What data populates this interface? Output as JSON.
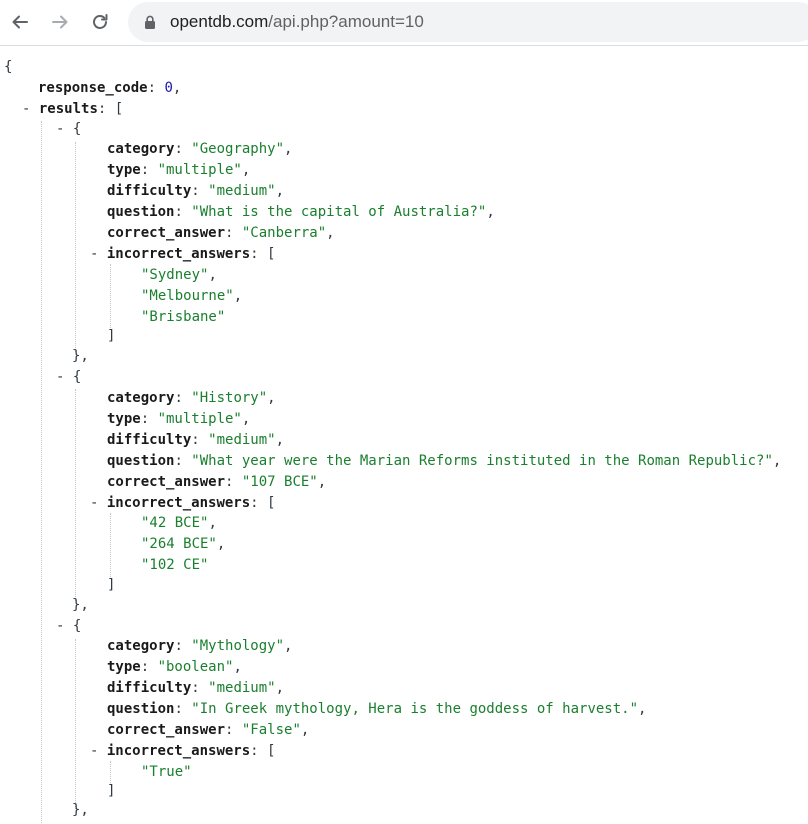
{
  "browser": {
    "url_host": "opentdb.com",
    "url_path": "/api.php?amount=10",
    "icons": {
      "back": "back-arrow-icon",
      "forward": "forward-arrow-icon",
      "reload": "reload-icon",
      "lock": "lock-icon"
    }
  },
  "json": {
    "open_brace": "{",
    "response_code_key": "response_code",
    "response_code_value": "0",
    "results_key": "results",
    "collapse_toggle": "-",
    "items": [
      {
        "category": "\"Geography\"",
        "type": "\"multiple\"",
        "difficulty": "\"medium\"",
        "question": "\"What is the capital of Australia?\"",
        "correct_answer": "\"Canberra\"",
        "incorrect_answers": [
          "\"Sydney\"",
          "\"Melbourne\"",
          "\"Brisbane\""
        ]
      },
      {
        "category": "\"History\"",
        "type": "\"multiple\"",
        "difficulty": "\"medium\"",
        "question": "\"What year were the Marian Reforms instituted in the Roman Republic?\"",
        "correct_answer": "\"107 BCE\"",
        "incorrect_answers": [
          "\"42 BCE\"",
          "\"264 BCE\"",
          "\"102 CE\""
        ]
      },
      {
        "category": "\"Mythology\"",
        "type": "\"boolean\"",
        "difficulty": "\"medium\"",
        "question": "\"In Greek mythology, Hera is the goddess of harvest.\"",
        "correct_answer": "\"False\"",
        "incorrect_answers": [
          "\"True\""
        ]
      }
    ],
    "field_keys": {
      "category": "category",
      "type": "type",
      "difficulty": "difficulty",
      "question": "question",
      "correct_answer": "correct_answer",
      "incorrect_answers": "incorrect_answers"
    }
  }
}
